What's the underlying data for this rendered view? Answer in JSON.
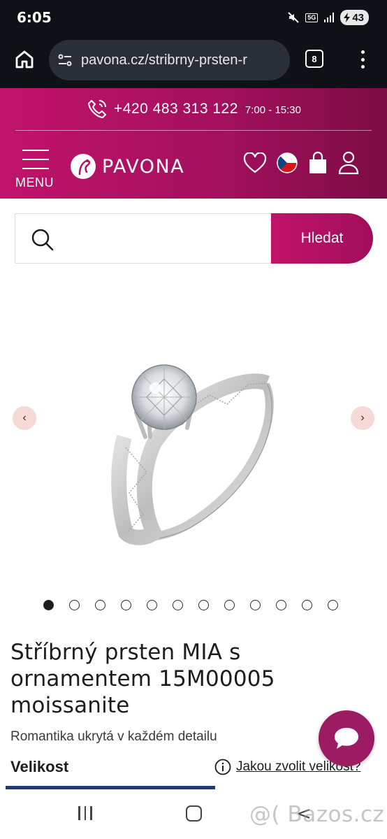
{
  "status_bar": {
    "time": "6:05",
    "network": "5G",
    "battery": "43"
  },
  "browser": {
    "url": "pavona.cz/stribrny-prsten-r",
    "tab_count": "8"
  },
  "header": {
    "phone": "+420 483 313 122",
    "hours": "7:00 - 15:30",
    "menu_label": "MENU",
    "logo_text": "PAVONA",
    "brand_color": "#b01163"
  },
  "search": {
    "placeholder": "",
    "button_label": "Hledat"
  },
  "gallery": {
    "prev_label": "‹",
    "next_label": "›",
    "image_count": 12,
    "active_index": 0
  },
  "product": {
    "title": "Stříbrný prsten MIA s ornamentem 15M00005 moissanite",
    "subtitle": "Romantika ukrytá v každém detailu",
    "size_label": "Velikost",
    "size_help": "Jakou zvolit velikost?"
  },
  "watermark": "@( Bazos.cz"
}
